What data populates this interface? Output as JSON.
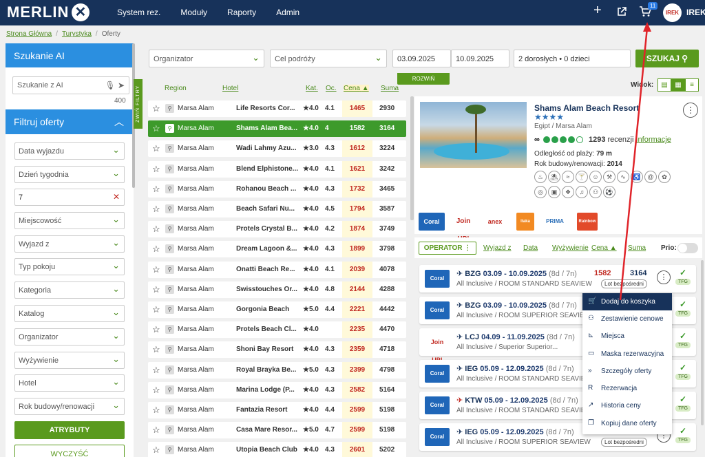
{
  "app": {
    "logo": "MERLIN",
    "logo_mark": "✕"
  },
  "nav": [
    "System rez.",
    "Moduły",
    "Raporty",
    "Admin"
  ],
  "cart_count": "11",
  "user": {
    "avatar_text": "IREK",
    "name": "IREK"
  },
  "breadcrumb": [
    "Strona Główna",
    "Turystyka",
    "Oferty"
  ],
  "ai": {
    "title": "Szukanie AI",
    "placeholder": "Szukanie z AI",
    "count": "400"
  },
  "filters": {
    "title": "Filtruj oferty",
    "fields": [
      "Data wyjazdu",
      "Dzień tygodnia",
      "7",
      "Miejscowość",
      "Wyjazd z",
      "Typ pokoju",
      "Kategoria",
      "Katalog",
      "Organizator",
      "Wyżywienie",
      "Hotel",
      "Rok budowy/renowacji"
    ],
    "attr_btn": "ATRYBUTY",
    "clear_btn": "WYCZYŚĆ",
    "collapse_label": "ZWIŃ FILTRY"
  },
  "search": {
    "organizer": "Organizator",
    "destination": "Cel podróży",
    "date_from": "03.09.2025",
    "date_to": "10.09.2025",
    "people": "2 dorosłych • 0 dzieci",
    "button": "SZUKAJ",
    "expand": "ROZWIŃ"
  },
  "list": {
    "headers": {
      "region": "Region",
      "hotel": "Hotel",
      "kat": "Kat.",
      "oc": "Oc.",
      "cena": "Cena",
      "suma": "Suma"
    },
    "rows": [
      {
        "region": "Marsa Alam",
        "hotel": "Life Resorts Cor...",
        "kat": "4.0",
        "oc": "4.1",
        "cena": "1465",
        "suma": "2930"
      },
      {
        "region": "Marsa Alam",
        "hotel": "Shams Alam Bea...",
        "kat": "4.0",
        "oc": "4",
        "cena": "1582",
        "suma": "3164"
      },
      {
        "region": "Marsa Alam",
        "hotel": "Wadi Lahmy Azu...",
        "kat": "3.0",
        "oc": "4.3",
        "cena": "1612",
        "suma": "3224"
      },
      {
        "region": "Marsa Alam",
        "hotel": "Blend Elphistone...",
        "kat": "4.0",
        "oc": "4.1",
        "cena": "1621",
        "suma": "3242"
      },
      {
        "region": "Marsa Alam",
        "hotel": "Rohanou Beach ...",
        "kat": "4.0",
        "oc": "4.3",
        "cena": "1732",
        "suma": "3465"
      },
      {
        "region": "Marsa Alam",
        "hotel": "Beach Safari Nu...",
        "kat": "4.0",
        "oc": "4.5",
        "cena": "1794",
        "suma": "3587"
      },
      {
        "region": "Marsa Alam",
        "hotel": "Protels Crystal B...",
        "kat": "4.0",
        "oc": "4.2",
        "cena": "1874",
        "suma": "3749"
      },
      {
        "region": "Marsa Alam",
        "hotel": "Dream Lagoon &...",
        "kat": "4.0",
        "oc": "4.3",
        "cena": "1899",
        "suma": "3798"
      },
      {
        "region": "Marsa Alam",
        "hotel": "Onatti Beach Re...",
        "kat": "4.0",
        "oc": "4.1",
        "cena": "2039",
        "suma": "4078"
      },
      {
        "region": "Marsa Alam",
        "hotel": "Swisstouches Or...",
        "kat": "4.0",
        "oc": "4.8",
        "cena": "2144",
        "suma": "4288"
      },
      {
        "region": "Marsa Alam",
        "hotel": "Gorgonia Beach",
        "kat": "5.0",
        "oc": "4.4",
        "cena": "2221",
        "suma": "4442"
      },
      {
        "region": "Marsa Alam",
        "hotel": "Protels Beach Cl...",
        "kat": "4.0",
        "oc": "",
        "cena": "2235",
        "suma": "4470"
      },
      {
        "region": "Marsa Alam",
        "hotel": "Shoni Bay Resort",
        "kat": "4.0",
        "oc": "4.3",
        "cena": "2359",
        "suma": "4718"
      },
      {
        "region": "Marsa Alam",
        "hotel": "Royal Brayka Be...",
        "kat": "5.0",
        "oc": "4.3",
        "cena": "2399",
        "suma": "4798"
      },
      {
        "region": "Marsa Alam",
        "hotel": "Marina Lodge (P...",
        "kat": "4.0",
        "oc": "4.3",
        "cena": "2582",
        "suma": "5164"
      },
      {
        "region": "Marsa Alam",
        "hotel": "Fantazia Resort",
        "kat": "4.0",
        "oc": "4.4",
        "cena": "2599",
        "suma": "5198"
      },
      {
        "region": "Marsa Alam",
        "hotel": "Casa Mare Resor...",
        "kat": "5.0",
        "oc": "4.7",
        "cena": "2599",
        "suma": "5198"
      },
      {
        "region": "Marsa Alam",
        "hotel": "Utopia Beach Club",
        "kat": "4.0",
        "oc": "4.3",
        "cena": "2601",
        "suma": "5202"
      }
    ]
  },
  "view": {
    "label": "Widok:"
  },
  "hotel": {
    "name": "Shams Alam Beach Resort",
    "stars": "★★★★",
    "location": "Egipt / Marsa Alam",
    "reviews": "1293",
    "reviews_label": "recenzji",
    "info_link": "Informacje",
    "beach_label": "Odległość od plaży:",
    "beach_value": "79 m",
    "built_label": "Rok budowy/renowacji:",
    "built_value": "2014"
  },
  "operators": [
    "Coral",
    "Join UP!",
    "anex",
    "Itaka",
    "PRIMA",
    "Rainbow"
  ],
  "offers_head": {
    "operator": "OPERATOR",
    "wyjazd": "Wyjazd z",
    "data": "Data",
    "wyzywienie": "Wyżywienie",
    "cena": "Cena",
    "suma": "Suma",
    "prio": "Prio:"
  },
  "offers": [
    {
      "op": "Coral",
      "code": "BZG",
      "dates": "03.09 - 10.09.2025",
      "nights": "(8d / 7n)",
      "board": "All Inclusive / ROOM STANDARD SEAVIEW",
      "price": "1582",
      "sum": "3164",
      "tag": "Lot bezpośredni",
      "tfg": "TFG"
    },
    {
      "op": "Coral",
      "code": "BZG",
      "dates": "03.09 - 10.09.2025",
      "nights": "(8d / 7n)",
      "board": "All Inclusive / ROOM SUPERIOR SEAVIEW",
      "price": "",
      "sum": "",
      "tag": "",
      "tfg": "TFG"
    },
    {
      "op": "Join UP!",
      "code": "LCJ",
      "dates": "04.09 - 11.09.2025",
      "nights": "(8d / 7n)",
      "board": "All Inclusive / Superior Superior...",
      "price": "",
      "sum": "",
      "tag": "Bagaż w c...",
      "tfg": "TFG"
    },
    {
      "op": "Coral",
      "code": "IEG",
      "dates": "05.09 - 12.09.2025",
      "nights": "(8d / 7n)",
      "board": "All Inclusive / ROOM STANDARD SEAVIEW",
      "price": "",
      "sum": "",
      "tag": "",
      "tfg": "TFG"
    },
    {
      "op": "Coral",
      "code": "KTW",
      "dates": "05.09 - 12.09.2025",
      "nights": "(8d / 7n)",
      "board": "All Inclusive / ROOM STANDARD SEAVIEW",
      "price": "",
      "sum": "",
      "tag": "",
      "tfg": "TFG"
    },
    {
      "op": "Coral",
      "code": "IEG",
      "dates": "05.09 - 12.09.2025",
      "nights": "(8d / 7n)",
      "board": "All Inclusive / ROOM SUPERIOR SEAVIEW",
      "price": "",
      "sum": "",
      "tag": "Lot bezpośredni",
      "tfg": "TFG"
    }
  ],
  "menu": [
    "Dodaj do koszyka",
    "Zestawienie cenowe",
    "Miejsca",
    "Maska rezerwacyjna",
    "Szczegóły oferty",
    "Rezerwacja",
    "Historia ceny",
    "Kopiuj dane oferty"
  ],
  "colors": {
    "navy": "#17325a",
    "green": "#5a9a1e",
    "blue": "#2b8fe0",
    "red": "#c0261e",
    "arrow": "#e0242a"
  }
}
